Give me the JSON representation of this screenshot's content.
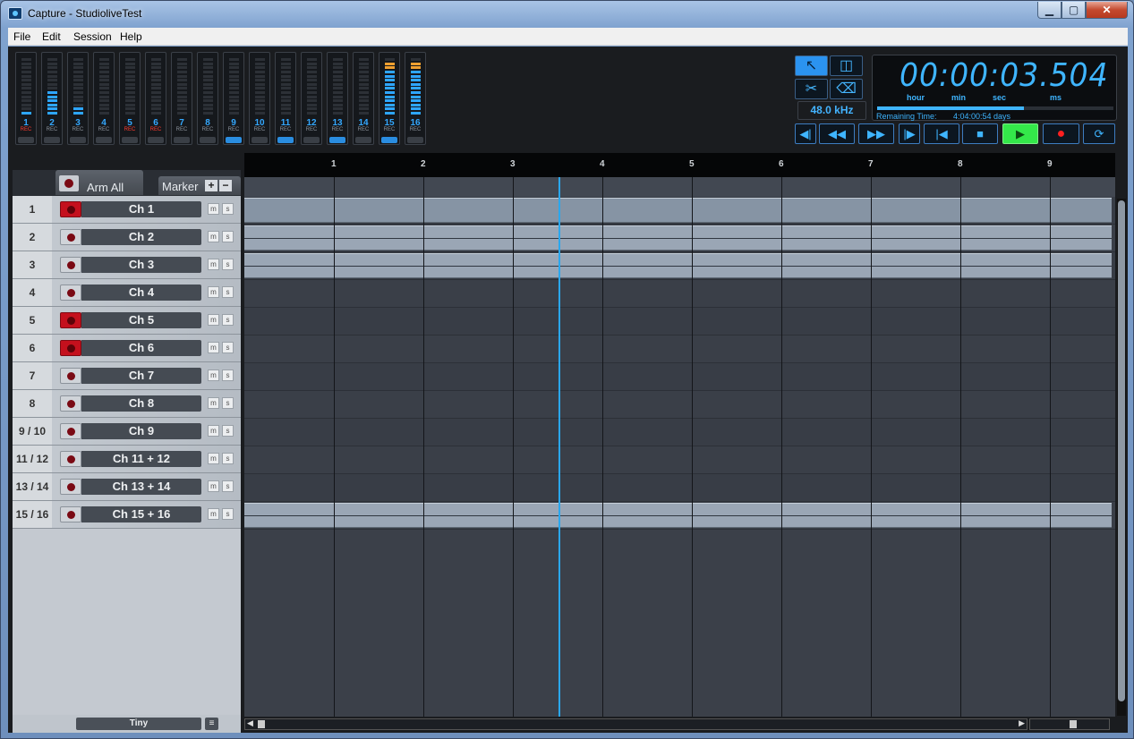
{
  "window": {
    "title": "Capture - StudioliveTest",
    "min": "▁",
    "max": "▢",
    "close": "✕"
  },
  "menu": [
    "File",
    "Edit",
    "Session",
    "Help"
  ],
  "meters": [
    {
      "num": "1",
      "rec": "REC",
      "armed": true,
      "level": 1,
      "link": false,
      "link_label": "LINK"
    },
    {
      "num": "2",
      "rec": "REC",
      "armed": false,
      "level": 6,
      "link": false,
      "link_label": ""
    },
    {
      "num": "3",
      "rec": "REC",
      "armed": false,
      "level": 2,
      "link": false,
      "link_label": "LINK"
    },
    {
      "num": "4",
      "rec": "REC",
      "armed": false,
      "level": 0,
      "link": false,
      "link_label": ""
    },
    {
      "num": "5",
      "rec": "REC",
      "armed": true,
      "level": 0,
      "link": false,
      "link_label": "LINK"
    },
    {
      "num": "6",
      "rec": "REC",
      "armed": true,
      "level": 0,
      "link": false,
      "link_label": ""
    },
    {
      "num": "7",
      "rec": "REC",
      "armed": false,
      "level": 0,
      "link": false,
      "link_label": "LINK"
    },
    {
      "num": "8",
      "rec": "REC",
      "armed": false,
      "level": 0,
      "link": false,
      "link_label": ""
    },
    {
      "num": "9",
      "rec": "REC",
      "armed": false,
      "level": 0,
      "link": true,
      "link_label": ""
    },
    {
      "num": "10",
      "rec": "REC",
      "armed": false,
      "level": 0,
      "link": false,
      "link_label": ""
    },
    {
      "num": "11",
      "rec": "REC",
      "armed": false,
      "level": 0,
      "link": true,
      "link_label": ""
    },
    {
      "num": "12",
      "rec": "REC",
      "armed": false,
      "level": 0,
      "link": false,
      "link_label": ""
    },
    {
      "num": "13",
      "rec": "REC",
      "armed": false,
      "level": 0,
      "link": true,
      "link_label": ""
    },
    {
      "num": "14",
      "rec": "REC",
      "armed": false,
      "level": 0,
      "link": false,
      "link_label": ""
    },
    {
      "num": "15",
      "rec": "REC",
      "armed": false,
      "level": 13,
      "link": true,
      "link_label": ""
    },
    {
      "num": "16",
      "rec": "REC",
      "armed": false,
      "level": 13,
      "link": false,
      "link_label": ""
    }
  ],
  "tools": {
    "arrow": "↖",
    "split": "◫",
    "scissors": "✂",
    "eraser": "⌫"
  },
  "sample_rate": "48.0 kHz",
  "clock": {
    "time": "00:00:03.504",
    "units": [
      "hour",
      "min",
      "sec",
      "ms"
    ],
    "remaining_label": "Remaining Time:",
    "remaining_value": "4:04:00:54 days",
    "progress": 0.62
  },
  "transport": {
    "prev_marker": "◀|",
    "rewind": "◀◀",
    "forward": "▶▶",
    "next_marker": "|▶",
    "to_start": "|◀",
    "stop": "■",
    "play": "▶",
    "record": "●",
    "loop": "⟳"
  },
  "tracklist": {
    "arm_all": "Arm All",
    "marker": "Marker",
    "marker_add": "+",
    "marker_remove": "−",
    "mute": "m",
    "solo": "s",
    "size": "Tiny",
    "list_icon": "≡",
    "tracks": [
      {
        "num": "1",
        "name": "Ch 1",
        "armed": true
      },
      {
        "num": "2",
        "name": "Ch 2",
        "armed": false
      },
      {
        "num": "3",
        "name": "Ch 3",
        "armed": false
      },
      {
        "num": "4",
        "name": "Ch 4",
        "armed": false
      },
      {
        "num": "5",
        "name": "Ch 5",
        "armed": true
      },
      {
        "num": "6",
        "name": "Ch 6",
        "armed": true
      },
      {
        "num": "7",
        "name": "Ch 7",
        "armed": false
      },
      {
        "num": "8",
        "name": "Ch 8",
        "armed": false
      },
      {
        "num": "9 / 10",
        "name": "Ch 9",
        "armed": false
      },
      {
        "num": "11 / 12",
        "name": "Ch 11 + 12",
        "armed": false
      },
      {
        "num": "13 / 14",
        "name": "Ch 13 + 14",
        "armed": false
      },
      {
        "num": "15 / 16",
        "name": "Ch 15 + 16",
        "armed": false
      }
    ]
  },
  "ruler": [
    "1",
    "2",
    "3",
    "4",
    "5",
    "6",
    "7",
    "8",
    "9"
  ],
  "clips": [
    1,
    2,
    3,
    12
  ],
  "scroll": {
    "left": "◀",
    "right": "▶"
  }
}
